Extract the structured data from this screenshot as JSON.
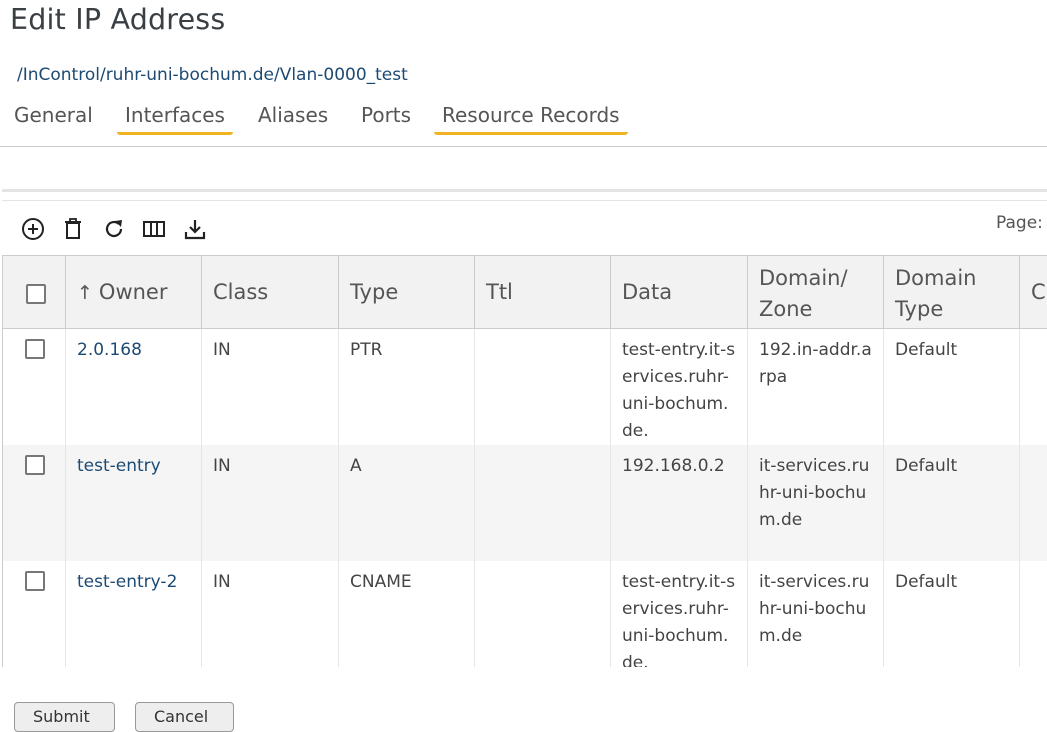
{
  "page": {
    "title": "Edit IP Address",
    "breadcrumb": "/InControl/ruhr-uni-bochum.de/Vlan-0000_test"
  },
  "tabs": [
    "General",
    "Interfaces",
    "Aliases",
    "Ports",
    "Resource Records"
  ],
  "toolbar": {
    "icons": [
      "add-icon",
      "delete-icon",
      "refresh-icon",
      "columns-icon",
      "download-icon"
    ],
    "page_label": "Page:"
  },
  "grid": {
    "sort_indicator": "↑",
    "columns": {
      "owner": "Owner",
      "class": "Class",
      "type": "Type",
      "ttl": "Ttl",
      "data": "Data",
      "domain_zone": "Domain/ Zone",
      "domain_type": "Domain Type",
      "cut": "C"
    },
    "rows": [
      {
        "owner": "2.0.168",
        "class": "IN",
        "type": "PTR",
        "ttl": "",
        "data": "test-entry.it-services.ruhr-uni-bochum.de.",
        "domain_zone": "192.in-addr.arpa",
        "domain_type": "Default"
      },
      {
        "owner": "test-entry",
        "class": "IN",
        "type": "A",
        "ttl": "",
        "data": "192.168.0.2",
        "domain_zone": "it-services.ruhr-uni-bochum.de",
        "domain_type": "Default"
      },
      {
        "owner": "test-entry-2",
        "class": "IN",
        "type": "CNAME",
        "ttl": "",
        "data": "test-entry.it-services.ruhr-uni-bochum.de.",
        "domain_zone": "it-services.ruhr-uni-bochum.de",
        "domain_type": "Default"
      }
    ]
  },
  "buttons": {
    "submit": "Submit",
    "cancel": "Cancel"
  },
  "colors": {
    "accent": "#f0b323",
    "link": "#1d4a73",
    "header_bg": "#f2f2f2"
  }
}
